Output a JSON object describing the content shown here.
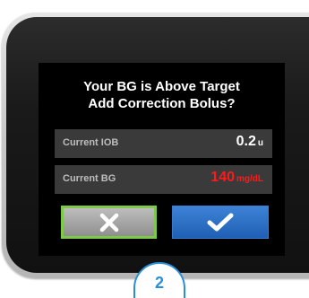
{
  "dialog": {
    "title_line1": "Your BG is Above Target",
    "title_line2": "Add Correction Bolus?"
  },
  "rows": {
    "iob": {
      "label": "Current IOB",
      "value": "0.2",
      "unit": "u"
    },
    "bg": {
      "label": "Current BG",
      "value": "140",
      "unit": "mg/dL"
    }
  },
  "buttons": {
    "cancel_icon": "x-icon",
    "confirm_icon": "checkmark-icon"
  },
  "step": {
    "number": "2"
  },
  "colors": {
    "bg_value": "#ff1a1a",
    "cancel_border": "#7ec84a",
    "confirm_fill": "#2f72c8",
    "step_accent": "#2a8fd6"
  }
}
